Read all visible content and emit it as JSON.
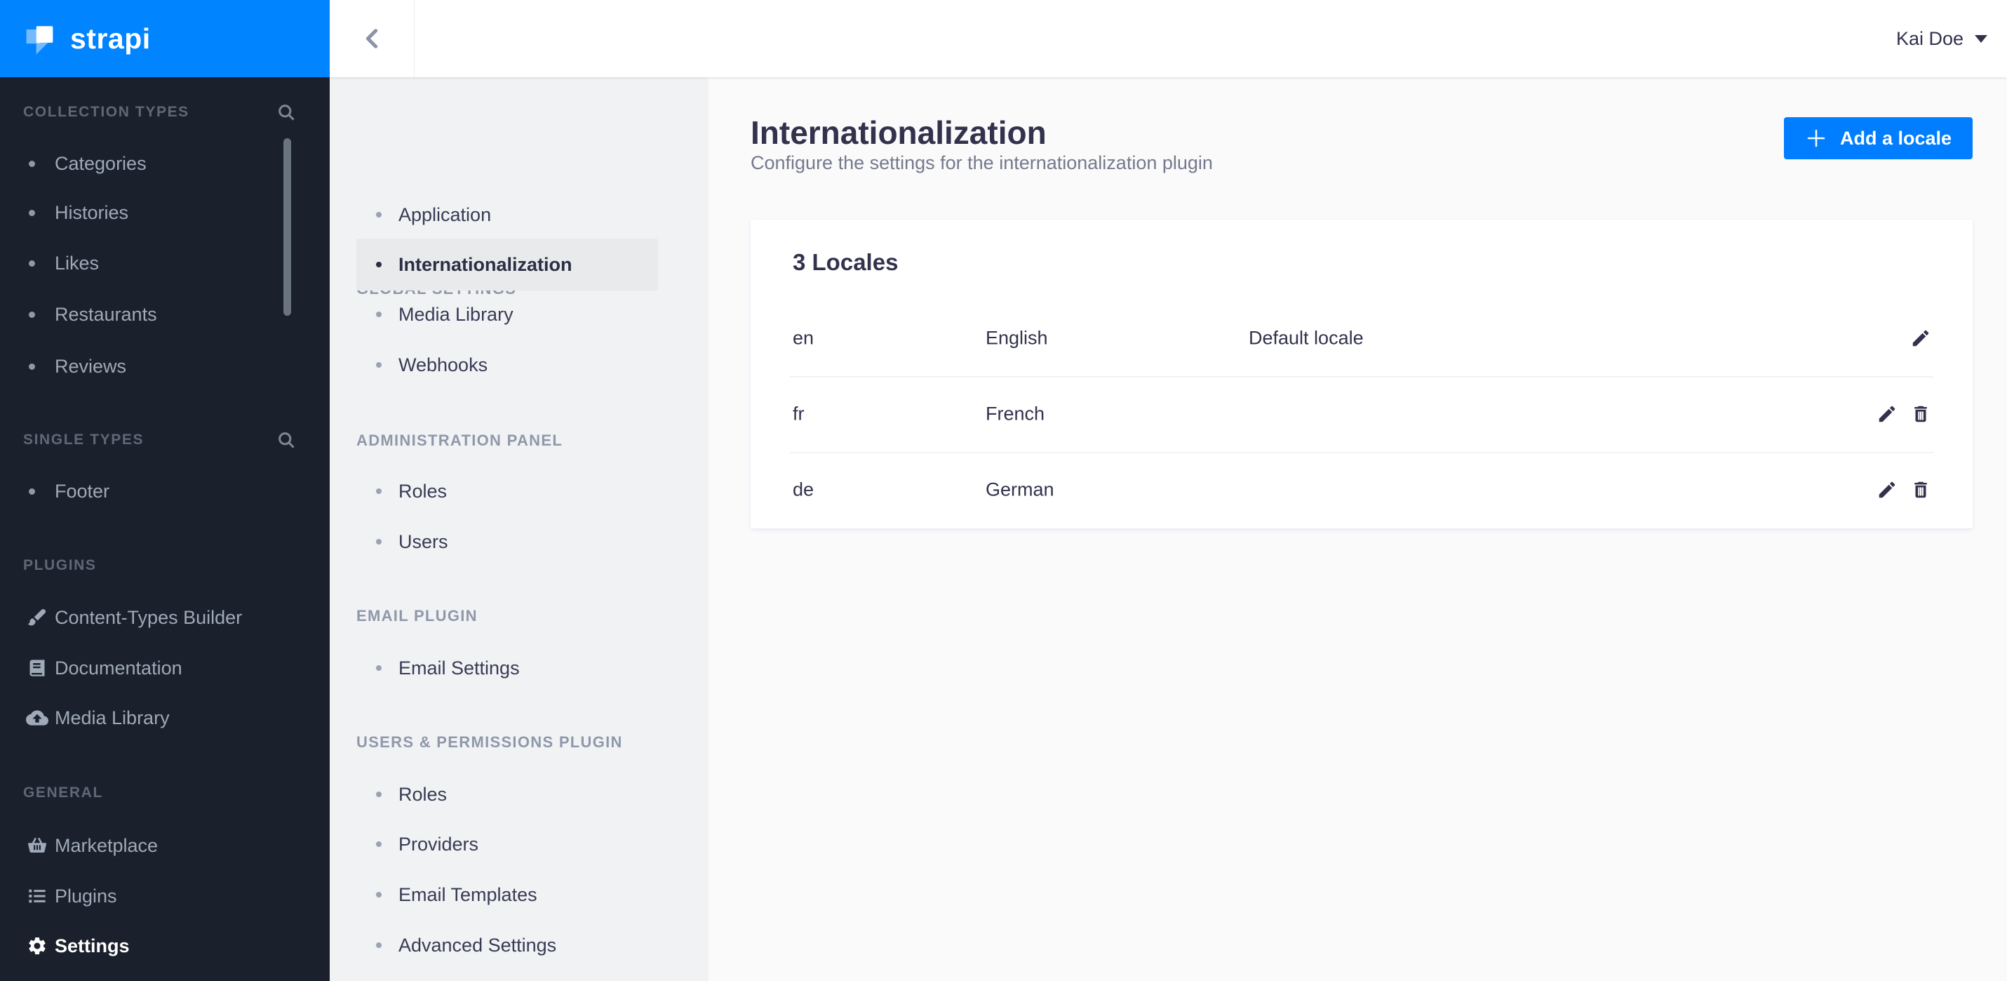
{
  "brand": {
    "logo_text": "strapi"
  },
  "colors": {
    "brand_blue": "#007EFF",
    "logo_bg": "#0084FF",
    "sidebar_bg": "#1A212C",
    "settings_nav_bg": "#F1F2F4",
    "selected_item_bg": "#E9EAEB",
    "main_bg": "#FAFAFB",
    "card_bg": "#FFFFFF",
    "text_dark": "#32324D",
    "text_muted": "#75798C"
  },
  "topbar": {
    "user_name": "Kai Doe",
    "back_icon": "chevron-left-icon",
    "caret_icon": "caret-down-icon"
  },
  "left_sidebar": {
    "sections": [
      {
        "label": "COLLECTION TYPES",
        "has_search": true,
        "items": [
          {
            "label": "Categories",
            "icon": "bullet"
          },
          {
            "label": "Histories",
            "icon": "bullet"
          },
          {
            "label": "Likes",
            "icon": "bullet"
          },
          {
            "label": "Restaurants",
            "icon": "bullet"
          },
          {
            "label": "Reviews",
            "icon": "bullet"
          }
        ]
      },
      {
        "label": "SINGLE TYPES",
        "has_search": true,
        "items": [
          {
            "label": "Footer",
            "icon": "bullet"
          }
        ]
      },
      {
        "label": "PLUGINS",
        "has_search": false,
        "items": [
          {
            "label": "Content-Types Builder",
            "icon": "brush-icon"
          },
          {
            "label": "Documentation",
            "icon": "book-icon"
          },
          {
            "label": "Media Library",
            "icon": "cloud-upload-icon"
          }
        ]
      },
      {
        "label": "GENERAL",
        "has_search": false,
        "items": [
          {
            "label": "Marketplace",
            "icon": "basket-icon"
          },
          {
            "label": "Plugins",
            "icon": "list-icon"
          },
          {
            "label": "Settings",
            "icon": "gear-icon",
            "active": true
          }
        ]
      }
    ]
  },
  "settings_nav": {
    "groups": [
      {
        "header": "",
        "items": [
          {
            "label": "Application",
            "selected": false
          }
        ]
      },
      {
        "header": "GLOBAL SETTINGS",
        "items": [
          {
            "label": "Internationalization",
            "selected": true
          },
          {
            "label": "Media Library",
            "selected": false
          },
          {
            "label": "Webhooks",
            "selected": false
          }
        ]
      },
      {
        "header": "ADMINISTRATION PANEL",
        "items": [
          {
            "label": "Roles",
            "selected": false
          },
          {
            "label": "Users",
            "selected": false
          }
        ]
      },
      {
        "header": "EMAIL PLUGIN",
        "items": [
          {
            "label": "Email Settings",
            "selected": false
          }
        ]
      },
      {
        "header": "USERS & PERMISSIONS PLUGIN",
        "items": [
          {
            "label": "Roles",
            "selected": false
          },
          {
            "label": "Providers",
            "selected": false
          },
          {
            "label": "Email Templates",
            "selected": false
          },
          {
            "label": "Advanced Settings",
            "selected": false
          }
        ]
      }
    ]
  },
  "main": {
    "title": "Internationalization",
    "subtitle": "Configure the settings for the internationalization plugin",
    "add_button_label": "Add a locale",
    "card": {
      "title": "3 Locales",
      "rows": [
        {
          "code": "en",
          "name": "English",
          "note": "Default locale",
          "can_delete": false
        },
        {
          "code": "fr",
          "name": "French",
          "note": "",
          "can_delete": true
        },
        {
          "code": "de",
          "name": "German",
          "note": "",
          "can_delete": true
        }
      ]
    }
  }
}
